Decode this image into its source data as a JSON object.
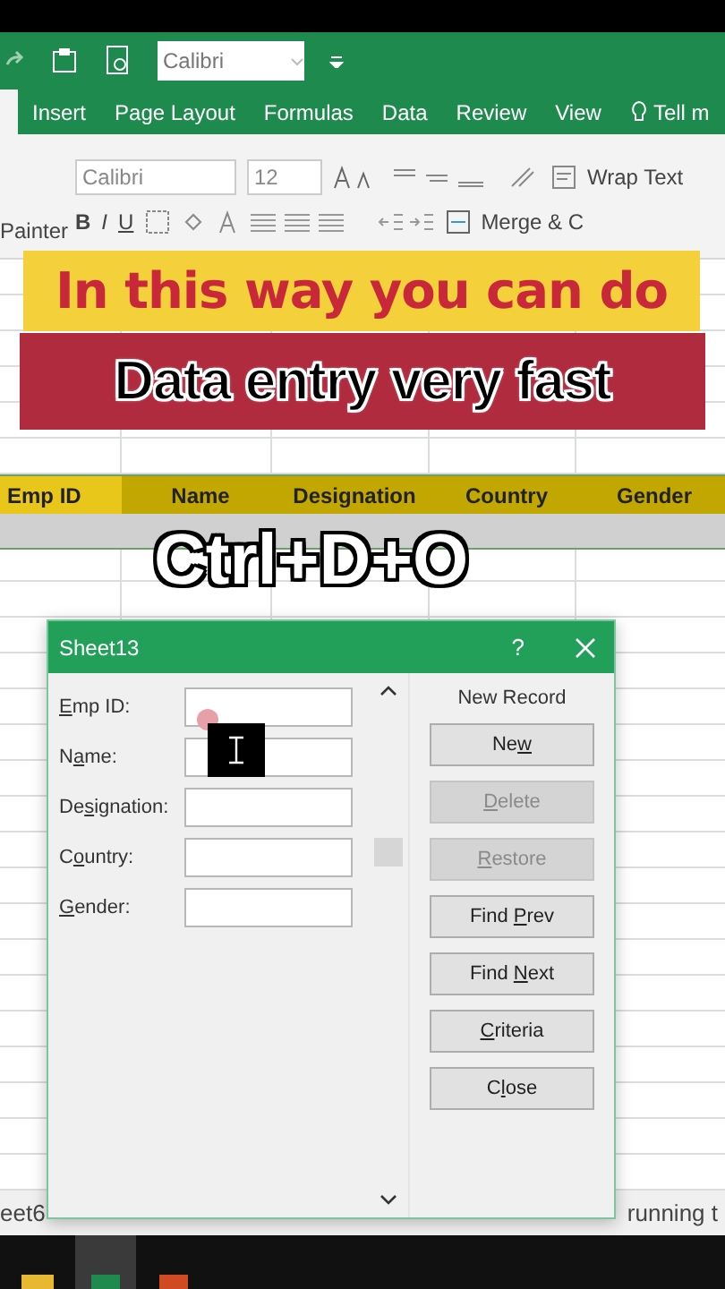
{
  "quick_access": {
    "font_field": "Calibri"
  },
  "ribbon_tabs": [
    {
      "label": "Insert"
    },
    {
      "label": "Page Layout"
    },
    {
      "label": "Formulas"
    },
    {
      "label": "Data"
    },
    {
      "label": "Review"
    },
    {
      "label": "View"
    },
    {
      "label": "Tell m",
      "kind": "search"
    }
  ],
  "ribbon": {
    "font_name": "Calibri",
    "font_size": "12",
    "wrap_text": "Wrap Text",
    "merge": "Merge & C",
    "clipboard_label": "Painter",
    "bold": "B",
    "italic": "I",
    "underline": "U"
  },
  "captions": {
    "line_1": "In this way you can do",
    "line_2": "Data entry very fast",
    "shortcut": "Ctrl+D+O"
  },
  "sheet": {
    "columns": [
      {
        "label": "Emp ID",
        "selected": true
      },
      {
        "label": "Name",
        "selected": false
      },
      {
        "label": "Designation",
        "selected": false
      },
      {
        "label": "Country",
        "selected": false
      },
      {
        "label": "Gender",
        "selected": false
      }
    ]
  },
  "dialog": {
    "title": "Sheet13",
    "help": "?",
    "record_status": "New Record",
    "fields": [
      {
        "access_key": "E",
        "after": "mp ID:"
      },
      {
        "before": "N",
        "access_key": "a",
        "after": "me:"
      },
      {
        "before": "De",
        "access_key": "s",
        "after": "ignation:"
      },
      {
        "before": "C",
        "access_key": "o",
        "after": "untry:"
      },
      {
        "access_key": "G",
        "after": "ender:"
      }
    ],
    "button_groups": [
      [
        {
          "before": "Ne",
          "access_key": "w",
          "disabled": false
        },
        {
          "access_key": "D",
          "after": "elete",
          "disabled": true
        },
        {
          "access_key": "R",
          "after": "estore",
          "disabled": true
        }
      ],
      [
        {
          "before": "Find ",
          "access_key": "P",
          "after": "rev",
          "disabled": false
        },
        {
          "before": "Find ",
          "access_key": "N",
          "after": "ext",
          "disabled": false
        },
        {
          "access_key": "C",
          "after": "riteria",
          "disabled": false
        }
      ],
      [
        {
          "before": "C",
          "access_key": "l",
          "after": "ose",
          "disabled": false
        }
      ]
    ]
  },
  "status_bar": {
    "sheet_tab": "eet6",
    "message": "running t"
  }
}
